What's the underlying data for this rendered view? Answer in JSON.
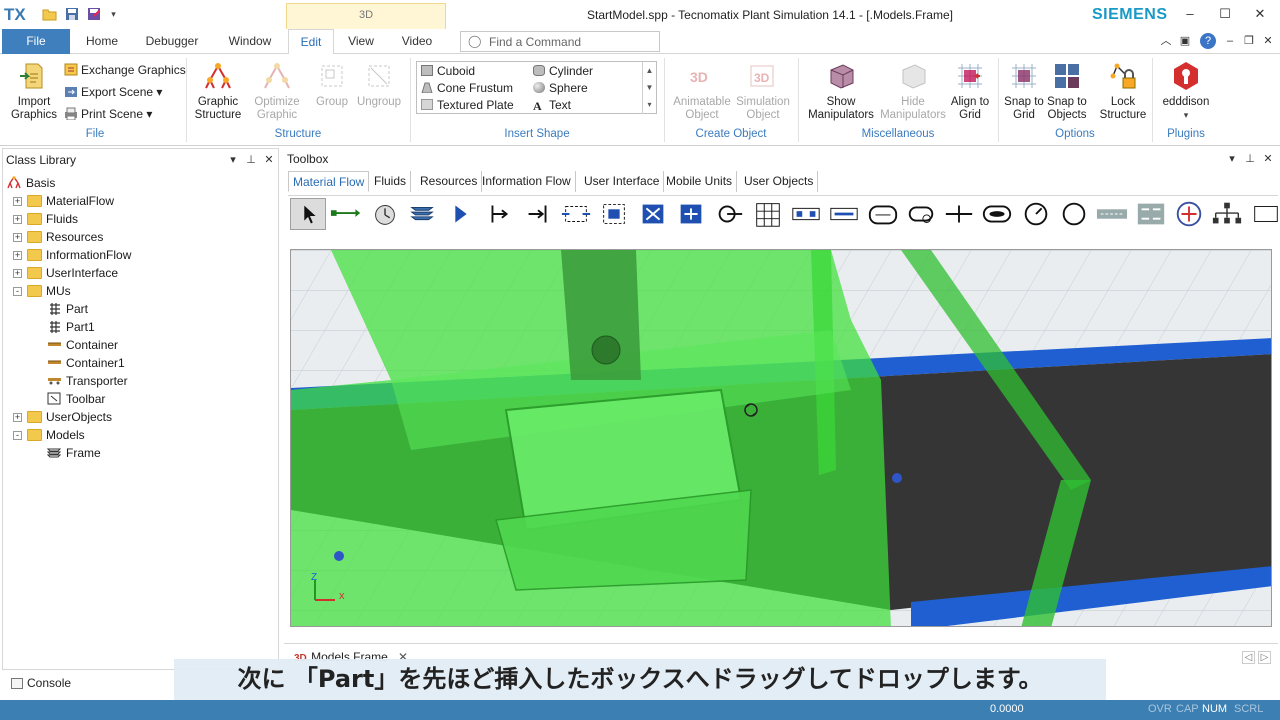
{
  "app": {
    "logo": "TX",
    "window_title": "StartModel.spp - Tecnomatix Plant Simulation 14.1 - [.Models.Frame]",
    "brand": "SIEMENS",
    "context_tab": "3D"
  },
  "ribbon_tabs": [
    "File",
    "Home",
    "Debugger",
    "Window",
    "Edit",
    "View",
    "Video"
  ],
  "active_tab": "Edit",
  "find_command": {
    "placeholder": "Find a Command"
  },
  "ribbon": {
    "file_group": {
      "label": "File",
      "import_graphics": "Import Graphics",
      "exchange_graphics": "Exchange Graphics",
      "export_scene": "Export Scene",
      "print_scene": "Print Scene"
    },
    "structure_group": {
      "label": "Structure",
      "graphic_structure": "Graphic Structure",
      "optimize_graphic": "Optimize Graphic",
      "group": "Group",
      "ungroup": "Ungroup"
    },
    "insert_shape_group": {
      "label": "Insert Shape",
      "shapes": [
        "Cuboid",
        "Cylinder",
        "Cone Frustum",
        "Sphere",
        "Textured Plate",
        "Text"
      ]
    },
    "create_object_group": {
      "label": "Create Object",
      "animatable_object": "Animatable Object",
      "simulation_object": "Simulation Object"
    },
    "misc_group": {
      "label": "Miscellaneous",
      "show_manipulators": "Show Manipulators",
      "hide_manipulators": "Hide Manipulators",
      "align_to_grid": "Align to Grid"
    },
    "options_group": {
      "label": "Options",
      "snap_to_grid": "Snap to Grid",
      "snap_to_objects": "Snap to Objects",
      "lock_structure": "Lock Structure"
    },
    "plugins_group": {
      "label": "Plugins",
      "edddison": "edddison"
    }
  },
  "class_library": {
    "title": "Class Library",
    "items": [
      {
        "label": "Basis",
        "level": 0,
        "icon": "basis-icon",
        "expander": ""
      },
      {
        "label": "MaterialFlow",
        "level": 1,
        "icon": "folder-icon",
        "expander": "+"
      },
      {
        "label": "Fluids",
        "level": 1,
        "icon": "folder-icon",
        "expander": "+"
      },
      {
        "label": "Resources",
        "level": 1,
        "icon": "folder-icon",
        "expander": "+"
      },
      {
        "label": "InformationFlow",
        "level": 1,
        "icon": "folder-icon",
        "expander": "+"
      },
      {
        "label": "UserInterface",
        "level": 1,
        "icon": "folder-icon",
        "expander": "+"
      },
      {
        "label": "MUs",
        "level": 1,
        "icon": "folder-icon",
        "expander": "-"
      },
      {
        "label": "Part",
        "level": 2,
        "icon": "part-icon",
        "expander": ""
      },
      {
        "label": "Part1",
        "level": 2,
        "icon": "part-icon",
        "expander": ""
      },
      {
        "label": "Container",
        "level": 2,
        "icon": "container-icon",
        "expander": ""
      },
      {
        "label": "Container1",
        "level": 2,
        "icon": "container-icon",
        "expander": ""
      },
      {
        "label": "Transporter",
        "level": 2,
        "icon": "transporter-icon",
        "expander": ""
      },
      {
        "label": "Toolbar",
        "level": 2,
        "icon": "toolbar-icon",
        "expander": ""
      },
      {
        "label": "UserObjects",
        "level": 1,
        "icon": "folder-icon",
        "expander": "+"
      },
      {
        "label": "Models",
        "level": 1,
        "icon": "folder-icon",
        "expander": "-"
      },
      {
        "label": "Frame",
        "level": 2,
        "icon": "frame-icon",
        "expander": ""
      }
    ]
  },
  "toolbox": {
    "title": "Toolbox",
    "tabs": [
      "Material Flow",
      "Fluids",
      "Resources",
      "Information Flow",
      "User Interface",
      "Mobile Units",
      "User Objects"
    ],
    "active_tab": "Material Flow",
    "tools": [
      "pointer-icon",
      "connector-icon",
      "eventcontroller-icon",
      "frame-icon",
      "source-icon",
      "singleproc-icon",
      "drain-icon",
      "parallelproc-icon",
      "assembly-icon",
      "dismantle-icon",
      "store-icon",
      "cycle-icon",
      "line-icon",
      "buffer-icon",
      "placebuffer-icon",
      "sorter-icon",
      "conveyor-icon",
      "turntable-icon",
      "transfer-icon",
      "track-icon",
      "turnplate-icon",
      "angularconverter-icon",
      "flowcontrol-icon",
      "shelf-icon",
      "generator-icon",
      "network-icon"
    ]
  },
  "document_tab": {
    "badge": "3D",
    "label": ".Models.Frame"
  },
  "console": {
    "label": "Console"
  },
  "status": {
    "value": "0.0000",
    "indicators": [
      {
        "label": "OVR",
        "on": false
      },
      {
        "label": "CAP",
        "on": false
      },
      {
        "label": "NUM",
        "on": true
      },
      {
        "label": "SCRL",
        "on": false
      }
    ]
  },
  "caption": "次に 「Part」を先ほど挿入したボックスへドラッグしてドロップします。",
  "colors": {
    "file_tab": "#3f7fbd",
    "accent": "#2a6db5",
    "status_bar": "#3c7fb2",
    "selection_green": "#3ee03a",
    "conveyor_belt": "#353535",
    "conveyor_rail": "#1f5fd1",
    "siemens": "#199ac6"
  }
}
